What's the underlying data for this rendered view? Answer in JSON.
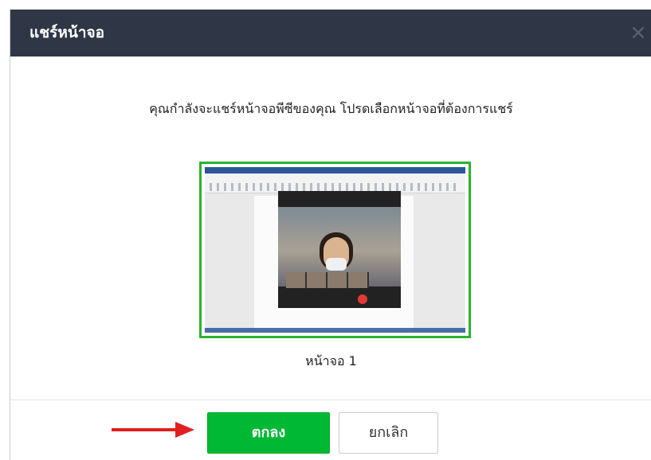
{
  "dialog": {
    "title": "แชร์หน้าจอ",
    "close_glyph": "×",
    "message": "คุณกำลังจะแชร์หน้าจอพีซีของคุณ โปรดเลือกหน้าจอที่ต้องการแชร์",
    "screens": [
      {
        "label": "หน้าจอ 1",
        "selected": true
      }
    ],
    "buttons": {
      "ok": "ตกลง",
      "cancel": "ยกเลิก"
    }
  },
  "colors": {
    "titlebar": "#2f3747",
    "ok_button": "#00b833",
    "selected_border": "#2ab32f",
    "annotation_arrow": "#e02020"
  }
}
